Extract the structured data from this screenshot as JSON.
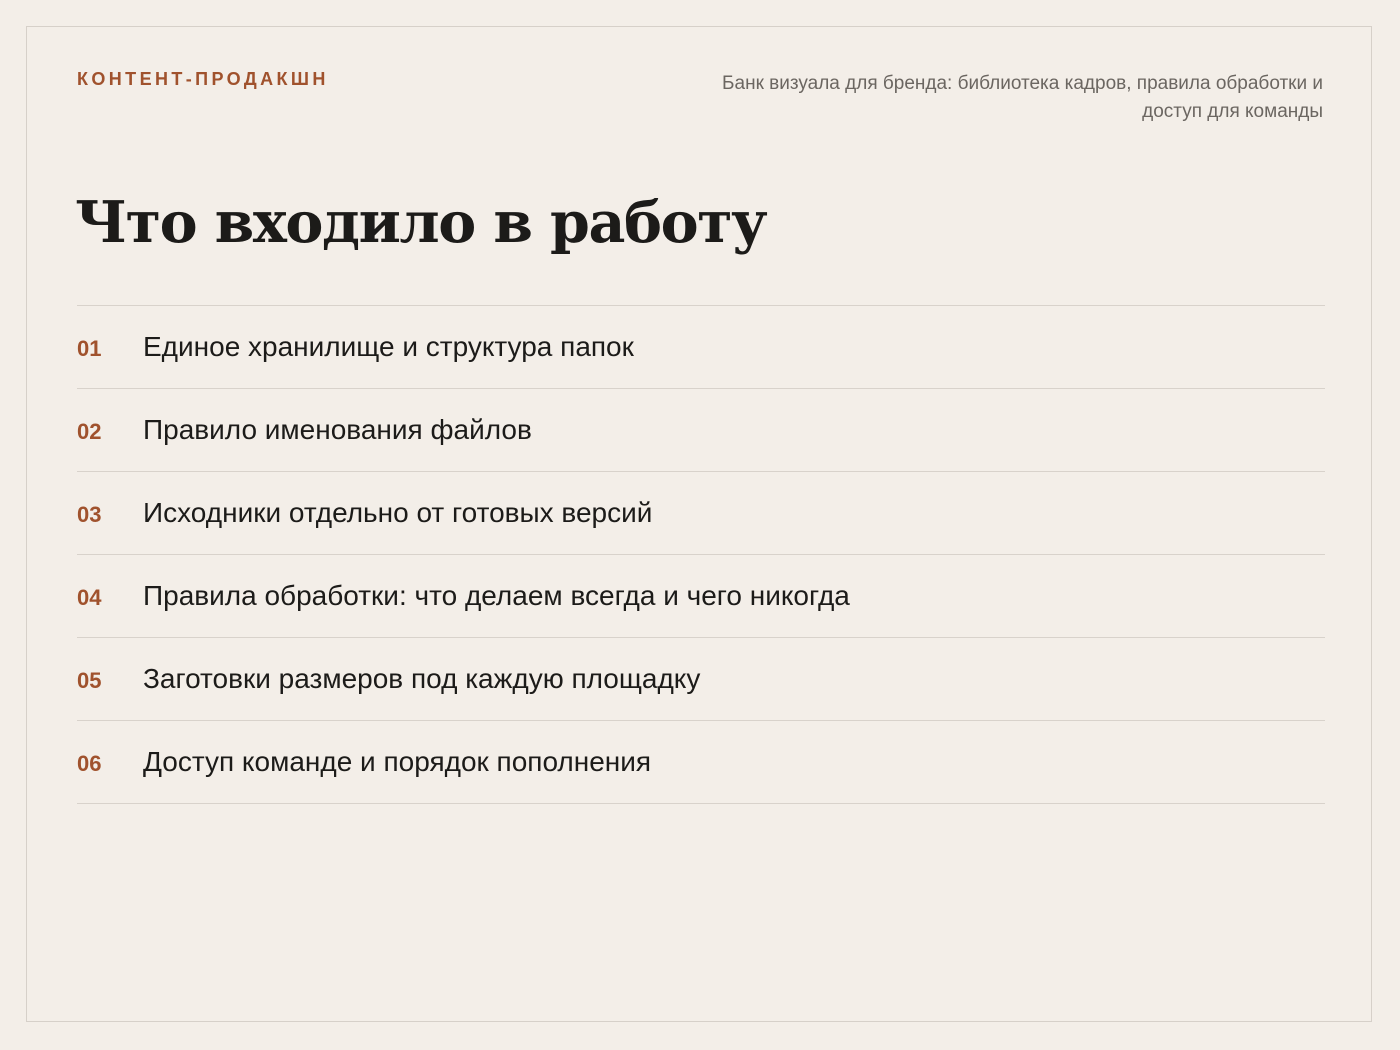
{
  "header": {
    "eyebrow": "КОНТЕНТ-ПРОДАКШН",
    "subtitle": "Банк визуала для бренда: библиотека кадров, правила обработки и доступ для команды"
  },
  "title": "Что входило в работу",
  "items": [
    {
      "num": "01",
      "text": "Единое хранилище и структура папок"
    },
    {
      "num": "02",
      "text": "Правило именования файлов"
    },
    {
      "num": "03",
      "text": "Исходники отдельно от готовых версий"
    },
    {
      "num": "04",
      "text": "Правила обработки: что делаем всегда и чего никогда"
    },
    {
      "num": "05",
      "text": "Заготовки размеров под каждую площадку"
    },
    {
      "num": "06",
      "text": "Доступ команде и порядок пополнения"
    }
  ],
  "colors": {
    "background": "#f3eee8",
    "accent": "#a0522d",
    "text": "#1c1b19",
    "muted": "#6b6661",
    "divider": "#d8d2cb"
  }
}
